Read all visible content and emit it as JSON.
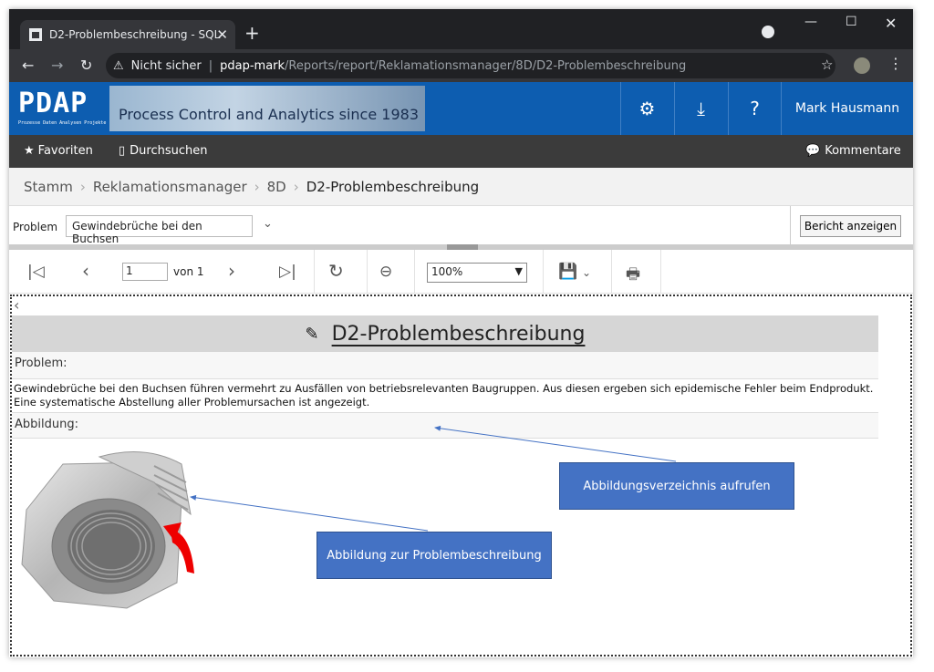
{
  "browser": {
    "tab_title": "D2-Problembeschreibung - SQL",
    "security_label": "Nicht sicher",
    "url_host": "pdap-mark",
    "url_path": "/Reports/report/Reklamationsmanager/8D/D2-Problembeschreibung",
    "icons": [
      "favicon-icon",
      "close-icon",
      "plus-icon",
      "back-icon",
      "forward-icon",
      "reload-icon",
      "warning-icon",
      "star-icon",
      "menu-icon"
    ]
  },
  "header": {
    "logo": "PDAP",
    "logo_sub": "Prozesse Daten Analysen Projekte",
    "tagline": "Process Control and Analytics since 1983",
    "user": "Mark Hausmann"
  },
  "menu": {
    "favorites": "Favoriten",
    "browse": "Durchsuchen",
    "comments": "Kommentare"
  },
  "breadcrumbs": [
    "Stamm",
    "Reklamationsmanager",
    "8D",
    "D2-Problembeschreibung"
  ],
  "params": {
    "label": "Problem",
    "value": "Gewindebrüche bei den Buchsen",
    "run_button": "Bericht anzeigen"
  },
  "toolbar": {
    "page": "1",
    "of_label": "von 1",
    "zoom": "100%"
  },
  "report": {
    "title": "D2-Problembeschreibung",
    "problem_label": "Problem:",
    "problem_text": "Gewindebrüche bei den Buchsen führen vermehrt zu Ausfällen von betriebsrelevanten Baugruppen. Aus diesen ergeben sich epidemische Fehler beim Endprodukt. Eine systematische Abstellung aller Problemursachen ist angezeigt.",
    "figure_label": "Abbildung:"
  },
  "callouts": {
    "figure_index": "Abbildungsverzeichnis aufrufen",
    "figure_desc": "Abbildung zur Problembeschreibung"
  },
  "colors": {
    "header_blue": "#0d5db0",
    "callout_blue": "#4472c4",
    "menubar": "#3b3b3b"
  }
}
